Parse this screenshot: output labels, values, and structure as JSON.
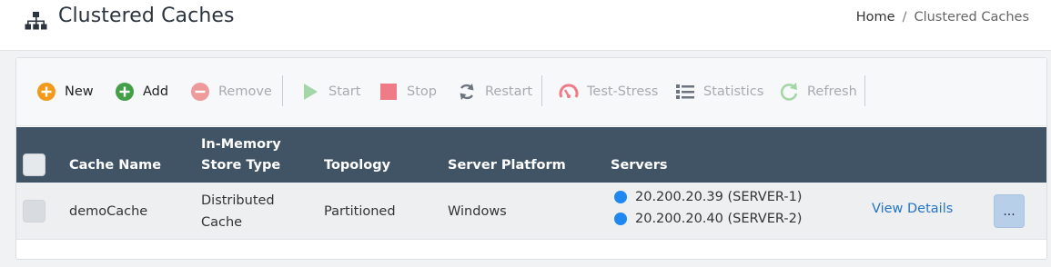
{
  "page": {
    "title": "Clustered Caches",
    "breadcrumb": {
      "home": "Home",
      "separator": "/",
      "current": "Clustered Caches"
    }
  },
  "toolbar": {
    "new": "New",
    "add": "Add",
    "remove": "Remove",
    "start": "Start",
    "stop": "Stop",
    "restart": "Restart",
    "test_stress": "Test-Stress",
    "statistics": "Statistics",
    "refresh": "Refresh"
  },
  "table": {
    "columns": {
      "cache_name": "Cache Name",
      "store_type_line1": "In-Memory",
      "store_type_line2": "Store Type",
      "topology": "Topology",
      "server_platform": "Server Platform",
      "servers": "Servers"
    },
    "rows": [
      {
        "cache_name": "demoCache",
        "store_type_line1": "Distributed",
        "store_type_line2": "Cache",
        "topology": "Partitioned",
        "platform": "Windows",
        "servers": [
          "20.200.20.39 (SERVER-1)",
          "20.200.20.40 (SERVER-2)"
        ],
        "view_details": "View Details",
        "more": "..."
      }
    ]
  },
  "colors": {
    "header_bg": "#415466",
    "server_status": "#1e88f0",
    "link": "#2374c6",
    "new_icon": "#f39a1c",
    "add_icon": "#43a047",
    "remove_icon": "#ef9a9a",
    "start_icon": "#a5d6a7",
    "stop_icon": "#ef7b86",
    "refresh_icon": "#a5d6a7"
  }
}
